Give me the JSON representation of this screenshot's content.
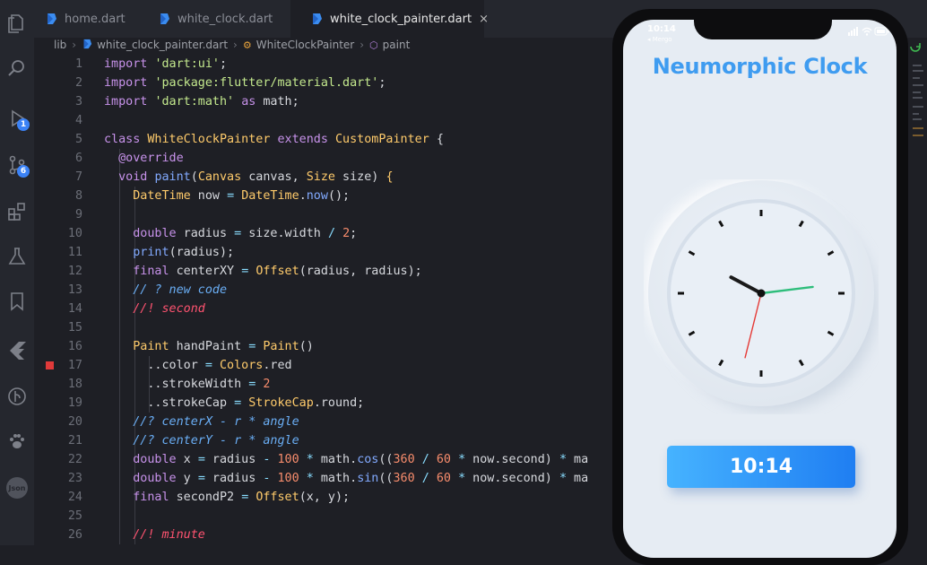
{
  "tabs": [
    {
      "label": "home.dart",
      "icon": "dart-file-icon",
      "active": false
    },
    {
      "label": "white_clock.dart",
      "icon": "dart-file-icon",
      "active": false
    },
    {
      "label": "white_clock_painter.dart",
      "icon": "dart-file-icon",
      "active": true,
      "close": "×"
    }
  ],
  "breadcrumb": {
    "root": "lib",
    "file": "white_clock_painter.dart",
    "class": "WhiteClockPainter",
    "method": "paint"
  },
  "activity_bar": {
    "items": [
      "explorer-icon",
      "search-icon",
      "run-debug-icon",
      "source-control-icon",
      "extensions-icon",
      "testing-icon",
      "bookmarks-icon",
      "flutter-icon",
      "git-graph-icon",
      "paw-icon",
      "json-icon"
    ],
    "badges": {
      "run_debug": "1",
      "source_control": "6"
    },
    "json_label": "Json"
  },
  "code": {
    "breakpoint_line": 17,
    "lines": [
      {
        "n": "1",
        "tokens": [
          [
            "kw",
            "import"
          ],
          [
            "id",
            " "
          ],
          [
            "str",
            "'dart:ui'"
          ],
          [
            "id",
            ";"
          ]
        ]
      },
      {
        "n": "2",
        "tokens": [
          [
            "kw",
            "import"
          ],
          [
            "id",
            " "
          ],
          [
            "str",
            "'package:flutter/material.dart'"
          ],
          [
            "id",
            ";"
          ]
        ]
      },
      {
        "n": "3",
        "tokens": [
          [
            "kw",
            "import"
          ],
          [
            "id",
            " "
          ],
          [
            "str",
            "'dart:math'"
          ],
          [
            "id",
            " "
          ],
          [
            "kw",
            "as"
          ],
          [
            "id",
            " math;"
          ]
        ]
      },
      {
        "n": "4",
        "tokens": []
      },
      {
        "n": "5",
        "tokens": [
          [
            "kw",
            "class"
          ],
          [
            "id",
            " "
          ],
          [
            "cls",
            "WhiteClockPainter"
          ],
          [
            "id",
            " "
          ],
          [
            "kw",
            "extends"
          ],
          [
            "id",
            " "
          ],
          [
            "cls",
            "CustomPainter"
          ],
          [
            "id",
            " {"
          ]
        ]
      },
      {
        "n": "6",
        "tokens": [
          [
            "id",
            "  "
          ],
          [
            "ann",
            "@override"
          ]
        ]
      },
      {
        "n": "7",
        "tokens": [
          [
            "id",
            "  "
          ],
          [
            "kw",
            "void"
          ],
          [
            "id",
            " "
          ],
          [
            "fn",
            "paint"
          ],
          [
            "id",
            "("
          ],
          [
            "cls",
            "Canvas"
          ],
          [
            "id",
            " canvas, "
          ],
          [
            "cls",
            "Size"
          ],
          [
            "id",
            " size) "
          ],
          [
            "gold",
            "{"
          ]
        ]
      },
      {
        "n": "8",
        "tokens": [
          [
            "id",
            "    "
          ],
          [
            "cls",
            "DateTime"
          ],
          [
            "id",
            " now "
          ],
          [
            "op",
            "="
          ],
          [
            "id",
            " "
          ],
          [
            "cls",
            "DateTime"
          ],
          [
            "id",
            "."
          ],
          [
            "fn",
            "now"
          ],
          [
            "id",
            "();"
          ]
        ]
      },
      {
        "n": "9",
        "tokens": []
      },
      {
        "n": "10",
        "tokens": [
          [
            "id",
            "    "
          ],
          [
            "kw",
            "double"
          ],
          [
            "id",
            " radius "
          ],
          [
            "op",
            "="
          ],
          [
            "id",
            " size.width "
          ],
          [
            "op",
            "/"
          ],
          [
            "id",
            " "
          ],
          [
            "num",
            "2"
          ],
          [
            "id",
            ";"
          ]
        ]
      },
      {
        "n": "11",
        "tokens": [
          [
            "id",
            "    "
          ],
          [
            "fn",
            "print"
          ],
          [
            "id",
            "(radius);"
          ]
        ]
      },
      {
        "n": "12",
        "tokens": [
          [
            "id",
            "    "
          ],
          [
            "kw",
            "final"
          ],
          [
            "id",
            " centerXY "
          ],
          [
            "op",
            "="
          ],
          [
            "id",
            " "
          ],
          [
            "cls",
            "Offset"
          ],
          [
            "id",
            "(radius, radius);"
          ]
        ]
      },
      {
        "n": "13",
        "tokens": [
          [
            "id",
            "    "
          ],
          [
            "cmt",
            "// ? new code"
          ]
        ]
      },
      {
        "n": "14",
        "tokens": [
          [
            "id",
            "    "
          ],
          [
            "red",
            "//! second"
          ]
        ]
      },
      {
        "n": "15",
        "tokens": []
      },
      {
        "n": "16",
        "tokens": [
          [
            "id",
            "    "
          ],
          [
            "cls",
            "Paint"
          ],
          [
            "id",
            " handPaint "
          ],
          [
            "op",
            "="
          ],
          [
            "id",
            " "
          ],
          [
            "cls",
            "Paint"
          ],
          [
            "id",
            "()"
          ]
        ]
      },
      {
        "n": "17",
        "tokens": [
          [
            "id",
            "      ..color "
          ],
          [
            "op",
            "="
          ],
          [
            "id",
            " "
          ],
          [
            "cls",
            "Colors"
          ],
          [
            "id",
            ".red"
          ]
        ]
      },
      {
        "n": "18",
        "tokens": [
          [
            "id",
            "      ..strokeWidth "
          ],
          [
            "op",
            "="
          ],
          [
            "id",
            " "
          ],
          [
            "num",
            "2"
          ]
        ]
      },
      {
        "n": "19",
        "tokens": [
          [
            "id",
            "      ..strokeCap "
          ],
          [
            "op",
            "="
          ],
          [
            "id",
            " "
          ],
          [
            "cls",
            "StrokeCap"
          ],
          [
            "id",
            ".round;"
          ]
        ]
      },
      {
        "n": "20",
        "tokens": [
          [
            "id",
            "    "
          ],
          [
            "cmt",
            "//? centerX - r * angle"
          ]
        ]
      },
      {
        "n": "21",
        "tokens": [
          [
            "id",
            "    "
          ],
          [
            "cmt",
            "//? centerY - r * angle"
          ]
        ]
      },
      {
        "n": "22",
        "tokens": [
          [
            "id",
            "    "
          ],
          [
            "kw",
            "double"
          ],
          [
            "id",
            " x "
          ],
          [
            "op",
            "="
          ],
          [
            "id",
            " radius "
          ],
          [
            "op",
            "-"
          ],
          [
            "id",
            " "
          ],
          [
            "num",
            "100"
          ],
          [
            "id",
            " "
          ],
          [
            "op",
            "*"
          ],
          [
            "id",
            " math."
          ],
          [
            "fn",
            "cos"
          ],
          [
            "id",
            "(("
          ],
          [
            "num",
            "360"
          ],
          [
            "id",
            " "
          ],
          [
            "op",
            "/"
          ],
          [
            "id",
            " "
          ],
          [
            "num",
            "60"
          ],
          [
            "id",
            " "
          ],
          [
            "op",
            "*"
          ],
          [
            "id",
            " now.second) "
          ],
          [
            "op",
            "*"
          ],
          [
            "id",
            " ma"
          ]
        ]
      },
      {
        "n": "23",
        "tokens": [
          [
            "id",
            "    "
          ],
          [
            "kw",
            "double"
          ],
          [
            "id",
            " y "
          ],
          [
            "op",
            "="
          ],
          [
            "id",
            " radius "
          ],
          [
            "op",
            "-"
          ],
          [
            "id",
            " "
          ],
          [
            "num",
            "100"
          ],
          [
            "id",
            " "
          ],
          [
            "op",
            "*"
          ],
          [
            "id",
            " math."
          ],
          [
            "fn",
            "sin"
          ],
          [
            "id",
            "(("
          ],
          [
            "num",
            "360"
          ],
          [
            "id",
            " "
          ],
          [
            "op",
            "/"
          ],
          [
            "id",
            " "
          ],
          [
            "num",
            "60"
          ],
          [
            "id",
            " "
          ],
          [
            "op",
            "*"
          ],
          [
            "id",
            " now.second) "
          ],
          [
            "op",
            "*"
          ],
          [
            "id",
            " ma"
          ]
        ]
      },
      {
        "n": "24",
        "tokens": [
          [
            "id",
            "    "
          ],
          [
            "kw",
            "final"
          ],
          [
            "id",
            " secondP2 "
          ],
          [
            "op",
            "="
          ],
          [
            "id",
            " "
          ],
          [
            "cls",
            "Offset"
          ],
          [
            "id",
            "(x, y);"
          ]
        ]
      },
      {
        "n": "25",
        "tokens": []
      },
      {
        "n": "26",
        "tokens": [
          [
            "id",
            "    "
          ],
          [
            "red",
            "//! minute"
          ]
        ]
      }
    ]
  },
  "phone": {
    "status_time": "10:14",
    "status_sub": "◂ Mergo",
    "app_title": "Neumorphic Clock",
    "time_button": "10:14",
    "clock": {
      "hour_angle_deg": -62,
      "minute_angle_deg": 83,
      "second_angle_deg": 194
    },
    "colors": {
      "title": "#3f9cf0",
      "second_hand": "#e53935",
      "minute_hand": "#2ebd7b",
      "hour_hand": "#1a1a1a"
    }
  }
}
